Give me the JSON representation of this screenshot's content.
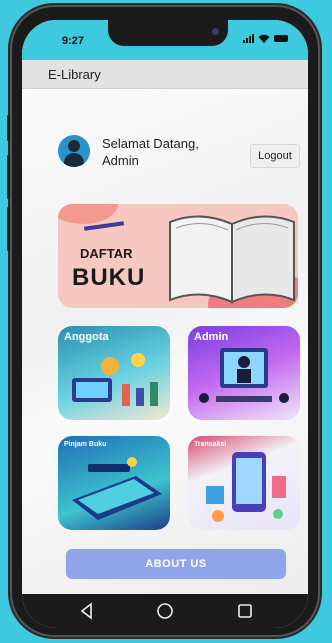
{
  "status_bar": {
    "time": "9:27"
  },
  "app_bar": {
    "title": "E-Library"
  },
  "greeting": {
    "line1": "Selamat Datang,",
    "line2": "Admin"
  },
  "logout_label": "Logout",
  "banner": {
    "line1": "DAFTAR",
    "line2": "BUKU"
  },
  "tiles": [
    {
      "label": "Anggota"
    },
    {
      "label": "Admin"
    },
    {
      "label": "Pinjam Buku"
    },
    {
      "label": "Transaksi"
    }
  ],
  "about_label": "ABOUT US",
  "colors": {
    "background": "#3fc9df",
    "about_button": "#8fa6ea",
    "app_bar": "#e2e2e2"
  },
  "icons": {
    "back": "back-icon",
    "home": "home-icon",
    "recent": "recent-apps-icon"
  }
}
